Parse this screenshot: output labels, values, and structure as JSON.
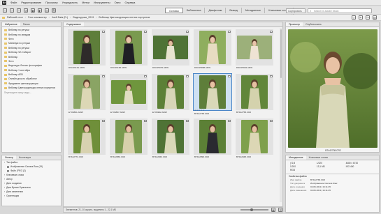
{
  "menu": {
    "logo": "Br",
    "items": [
      "Файл",
      "Редактирование",
      "Просмотр",
      "Упорядочить",
      "Метки",
      "Инструменты",
      "Окно",
      "Справка"
    ]
  },
  "workspaces": {
    "tabs": [
      "Основы",
      "Библиотека",
      "Диафильм",
      "Вывод",
      "Метаданные",
      "Ключевые слова"
    ],
    "active_index": 0
  },
  "sort": {
    "label": "Сортировать по: Имя"
  },
  "search": {
    "placeholder": "Search in Adobe Stock"
  },
  "path": {
    "crumbs": [
      "Рабочий стол",
      "Этот компьютер",
      "Joe6 Data (D:)",
      "Видеоуроки_2019",
      "Вебинар Цветокоррекция летних портретов"
    ]
  },
  "left_panel": {
    "tabs": [
      "Избранное",
      "Папки"
    ],
    "favorites": [
      "Вебинар по ретуши",
      "Вебинар по звездам",
      "Фото",
      "Минимум по ретуши",
      "Вебинар по ретуши",
      "Вебинар ЧБ Сибирит",
      "Вебинар",
      "Фото",
      "Видеокурс Летние фотографии",
      "Вебинар 1 сентября",
      "Вебинар AEB",
      "Онлайн урок по обработке",
      "Фундамент цветокоррекции",
      "Вебинар Цветокоррекция летних портретов"
    ],
    "hint": "Перетащите папку сюда..."
  },
  "filter_panel": {
    "tabs": [
      "Фильтр",
      "Коллекции"
    ],
    "rows": [
      {
        "label": "Тип файла",
        "sub": false
      },
      {
        "label": "Изображение Camera Raw (19)",
        "sub": true
      },
      {
        "label": "Файл JPEG (2)",
        "sub": true
      },
      {
        "label": "Ключевые слова",
        "sub": false
      },
      {
        "label": "Автор",
        "sub": false
      },
      {
        "label": "Дата создания",
        "sub": false
      },
      {
        "label": "Дата Время Оригинала",
        "sub": false
      },
      {
        "label": "Дата изменения",
        "sub": false
      },
      {
        "label": "Ориентация",
        "sub": false
      }
    ]
  },
  "content": {
    "tab": "Содержимое",
    "thumbnails": [
      {
        "name": "DSC06191.ARW",
        "orient": "port",
        "selected": false,
        "stars": ""
      },
      {
        "name": "DSC06196.ARW",
        "orient": "port",
        "selected": false,
        "stars": ""
      },
      {
        "name": "DSC05076.ARW",
        "orient": "land",
        "selected": false,
        "stars": ""
      },
      {
        "name": "DSC05858.ARW",
        "orient": "port",
        "selected": false,
        "stars": ""
      },
      {
        "name": "DSC05904.ARW",
        "orient": "land",
        "selected": false,
        "stars": ""
      },
      {
        "name": "EY06801.ARW",
        "orient": "port",
        "selected": false,
        "stars": ""
      },
      {
        "name": "EY06867.ARW",
        "orient": "land",
        "selected": false,
        "stars": ""
      },
      {
        "name": "EY06992.ARW",
        "orient": "port",
        "selected": false,
        "stars": ""
      },
      {
        "name": "B7442738.CR2",
        "orient": "port",
        "selected": true,
        "stars": "☆☆☆☆☆"
      },
      {
        "name": "B7442758.CR2",
        "orient": "port",
        "selected": false,
        "stars": ""
      },
      {
        "name": "B7442772.CR2",
        "orient": "port",
        "selected": false,
        "stars": ""
      },
      {
        "name": "B7442866.CR2",
        "orient": "port",
        "selected": false,
        "stars": ""
      },
      {
        "name": "B7442843.CR2",
        "orient": "port",
        "selected": false,
        "stars": ""
      },
      {
        "name": "B7442890.CR2",
        "orient": "port",
        "selected": false,
        "stars": ""
      },
      {
        "name": "B7442948.CR2",
        "orient": "port",
        "selected": false,
        "stars": ""
      }
    ]
  },
  "statusbar": {
    "text": "Элементов: 21, 10 скрыто, выделено 1 - 22,1 МБ"
  },
  "right_panel": {
    "tabs": [
      "Просмотр",
      "Опубликовать"
    ],
    "preview_name": "B7442738.CR2"
  },
  "meta_panel": {
    "tabs": [
      "Метаданные",
      "Ключевые слова"
    ],
    "grid": [
      "ƒ/2,8",
      "1/320",
      "4480 x 6720",
      "1/200",
      "13,1 МБ",
      "ISO 400",
      "RGB"
    ],
    "section": "Свойства файла",
    "rows": [
      {
        "k": "Имя файла",
        "v": "B7442738.CR2"
      },
      {
        "k": "Тип документа",
        "v": "Изображение Camera Raw"
      },
      {
        "k": "Дата создания",
        "v": "04.06.2019, 16:11:45"
      },
      {
        "k": "Дата изменения",
        "v": "04.06.2019, 16:11:45"
      }
    ]
  },
  "colors": {
    "selection": "#4a86c8",
    "folder": "#e8c56a",
    "grass": "#6f8f3a"
  }
}
